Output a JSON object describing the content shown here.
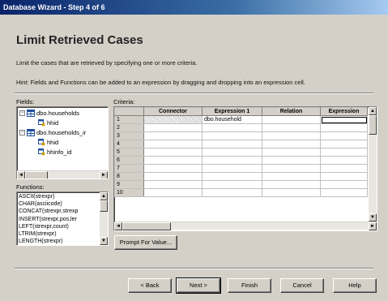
{
  "window": {
    "title": "Database Wizard - Step 4 of 6"
  },
  "page": {
    "title": "Limit Retrieved Cases",
    "description": "Limit the cases that are retrieved by specifying one or more criteria.",
    "hint": "Hint: Fields and Functions can be added to an expression by dragging and dropping into an expression cell."
  },
  "fields": {
    "label": "Fields:",
    "tree": [
      {
        "label": "dbo.households",
        "expander": "−"
      },
      {
        "label": "hhid"
      },
      {
        "label": "dbo.households_ir",
        "expander": "−"
      },
      {
        "label": "hhid"
      },
      {
        "label": "hhinfo_id"
      }
    ]
  },
  "functions": {
    "label": "Functions:",
    "items": [
      "ASCII(strexpr)",
      "CHAR(asciicode)",
      "CONCAT(strexpr,strexp",
      "INSERT(strexpr,pos,ler",
      "LEFT(strexpr,count)",
      "LTRIM(strexpr)",
      "LENGTH(strexpr)"
    ]
  },
  "criteria": {
    "label": "Criteria:",
    "columns": [
      "Connector",
      "Expression 1",
      "Relation",
      "Expression"
    ],
    "rows": [
      {
        "num": "1",
        "connector": "",
        "expression1": "dbo.household",
        "relation": "",
        "expression2": ""
      },
      {
        "num": "2",
        "connector": "",
        "expression1": "",
        "relation": "",
        "expression2": ""
      },
      {
        "num": "3",
        "connector": "",
        "expression1": "",
        "relation": "",
        "expression2": ""
      },
      {
        "num": "4",
        "connector": "",
        "expression1": "",
        "relation": "",
        "expression2": ""
      },
      {
        "num": "5",
        "connector": "",
        "expression1": "",
        "relation": "",
        "expression2": ""
      },
      {
        "num": "6",
        "connector": "",
        "expression1": "",
        "relation": "",
        "expression2": ""
      },
      {
        "num": "7",
        "connector": "",
        "expression1": "",
        "relation": "",
        "expression2": ""
      },
      {
        "num": "8",
        "connector": "",
        "expression1": "",
        "relation": "",
        "expression2": ""
      },
      {
        "num": "9",
        "connector": "",
        "expression1": "",
        "relation": "",
        "expression2": ""
      },
      {
        "num": "10",
        "connector": "",
        "expression1": "",
        "relation": "",
        "expression2": ""
      }
    ]
  },
  "buttons": {
    "prompt": "Prompt For Value...",
    "back": "< Back",
    "next": "Next >",
    "finish": "Finish",
    "cancel": "Cancel",
    "help": "Help"
  },
  "icons": {
    "expander": "tree-expander",
    "table": "table-icon",
    "column": "key-column-icon",
    "scroll_left": "◄",
    "scroll_right": "►",
    "scroll_up": "▲",
    "scroll_down": "▼"
  },
  "colors": {
    "titlebar_start": "#0a246a",
    "titlebar_end": "#a6caf0",
    "face": "#d4d0c8"
  }
}
